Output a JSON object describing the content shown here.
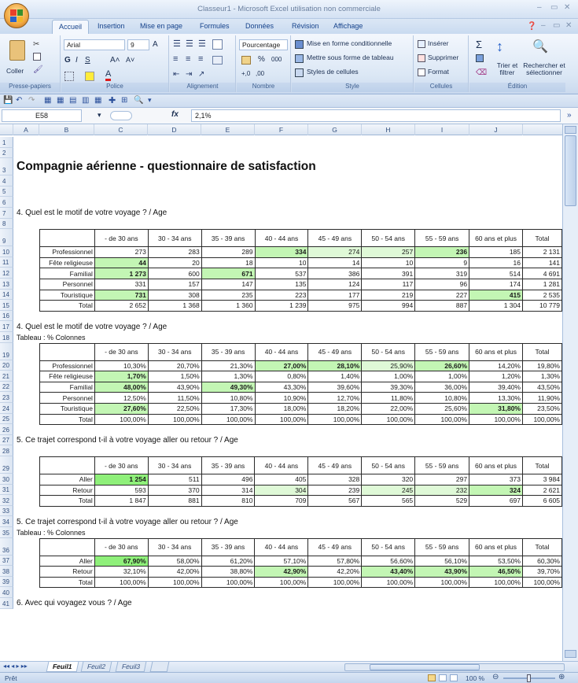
{
  "window": {
    "title": "Classeur1 - Microsoft Excel utilisation non commerciale"
  },
  "tabs": [
    "Accueil",
    "Insertion",
    "Mise en page",
    "Formules",
    "Données",
    "Révision",
    "Affichage"
  ],
  "ribbon": {
    "clipboard": {
      "paste": "Coller",
      "label": "Presse-papiers"
    },
    "font": {
      "name": "Arial",
      "size": "9",
      "label": "Police"
    },
    "alignment": {
      "label": "Alignement"
    },
    "number": {
      "format": "Pourcentage",
      "percent": "%",
      "thousands": "000",
      "label": "Nombre"
    },
    "style": {
      "cond": "Mise en forme conditionnelle",
      "table": "Mettre sous forme de tableau",
      "cell_styles": "Styles de cellules",
      "label": "Style"
    },
    "cells": {
      "insert": "Insérer",
      "delete": "Supprimer",
      "format": "Format",
      "label": "Cellules"
    },
    "editing": {
      "sort": "Trier et filtrer",
      "find": "Rechercher et sélectionner",
      "label": "Édition"
    }
  },
  "formula_bar": {
    "name_box": "E58",
    "fx": "fx",
    "value": "2,1%"
  },
  "columns": [
    "A",
    "B",
    "C",
    "D",
    "E",
    "F",
    "G",
    "H",
    "I",
    "J"
  ],
  "rows": [
    "1",
    "2",
    "3",
    "4",
    "5",
    "6",
    "7",
    "8",
    "9",
    "10",
    "11",
    "12",
    "13",
    "14",
    "15",
    "16",
    "17",
    "18",
    "19",
    "20",
    "21",
    "22",
    "23",
    "24",
    "25",
    "26",
    "27",
    "28",
    "29",
    "30",
    "31",
    "32",
    "33",
    "34",
    "35",
    "36",
    "37",
    "38",
    "39",
    "40",
    "41"
  ],
  "sheet": {
    "title": "Compagnie aérienne - questionnaire de satisfaction",
    "q1": "4. Quel est le motif de votre voyage ? / Age",
    "q2": "4. Quel est le motif de votre voyage ? / Age",
    "t2sub": "Tableau : % Colonnes",
    "q3": "5. Ce trajet correspond t-il à votre voyage aller ou retour ? / Age",
    "q4": "5. Ce trajet correspond t-il à votre voyage aller ou retour ? / Age",
    "t4sub": "Tableau : % Colonnes",
    "q5": "6. Avec qui voyagez vous ? / Age"
  },
  "age_headers": [
    "- de 30 ans",
    "30 - 34 ans",
    "35 - 39 ans",
    "40 - 44 ans",
    "45 - 49 ans",
    "50 - 54 ans",
    "55 - 59 ans",
    "60 ans et plus",
    "Total"
  ],
  "table1": [
    {
      "label": "Professionnel",
      "v": [
        "273",
        "283",
        "289",
        "334",
        "274",
        "257",
        "236",
        "185",
        "2 131"
      ]
    },
    {
      "label": "Fête religieuse",
      "v": [
        "44",
        "20",
        "18",
        "10",
        "14",
        "10",
        "9",
        "16",
        "141"
      ]
    },
    {
      "label": "Familial",
      "v": [
        "1 273",
        "600",
        "671",
        "537",
        "386",
        "391",
        "319",
        "514",
        "4 691"
      ]
    },
    {
      "label": "Personnel",
      "v": [
        "331",
        "157",
        "147",
        "135",
        "124",
        "117",
        "96",
        "174",
        "1 281"
      ]
    },
    {
      "label": "Touristique",
      "v": [
        "731",
        "308",
        "235",
        "223",
        "177",
        "219",
        "227",
        "415",
        "2 535"
      ]
    },
    {
      "label": "Total",
      "v": [
        "2 652",
        "1 368",
        "1 360",
        "1 239",
        "975",
        "994",
        "887",
        "1 304",
        "10 779"
      ]
    }
  ],
  "table2": [
    {
      "label": "Professionnel",
      "v": [
        "10,30%",
        "20,70%",
        "21,30%",
        "27,00%",
        "28,10%",
        "25,90%",
        "26,60%",
        "14,20%",
        "19,80%"
      ]
    },
    {
      "label": "Fête religieuse",
      "v": [
        "1,70%",
        "1,50%",
        "1,30%",
        "0,80%",
        "1,40%",
        "1,00%",
        "1,00%",
        "1,20%",
        "1,30%"
      ]
    },
    {
      "label": "Familial",
      "v": [
        "48,00%",
        "43,90%",
        "49,30%",
        "43,30%",
        "39,60%",
        "39,30%",
        "36,00%",
        "39,40%",
        "43,50%"
      ]
    },
    {
      "label": "Personnel",
      "v": [
        "12,50%",
        "11,50%",
        "10,80%",
        "10,90%",
        "12,70%",
        "11,80%",
        "10,80%",
        "13,30%",
        "11,90%"
      ]
    },
    {
      "label": "Touristique",
      "v": [
        "27,60%",
        "22,50%",
        "17,30%",
        "18,00%",
        "18,20%",
        "22,00%",
        "25,60%",
        "31,80%",
        "23,50%"
      ]
    },
    {
      "label": "Total",
      "v": [
        "100,00%",
        "100,00%",
        "100,00%",
        "100,00%",
        "100,00%",
        "100,00%",
        "100,00%",
        "100,00%",
        "100,00%"
      ]
    }
  ],
  "table3": [
    {
      "label": "Aller",
      "v": [
        "1 254",
        "511",
        "496",
        "405",
        "328",
        "320",
        "297",
        "373",
        "3 984"
      ]
    },
    {
      "label": "Retour",
      "v": [
        "593",
        "370",
        "314",
        "304",
        "239",
        "245",
        "232",
        "324",
        "2 621"
      ]
    },
    {
      "label": "Total",
      "v": [
        "1 847",
        "881",
        "810",
        "709",
        "567",
        "565",
        "529",
        "697",
        "6 605"
      ]
    }
  ],
  "table4": [
    {
      "label": "Aller",
      "v": [
        "67,90%",
        "58,00%",
        "61,20%",
        "57,10%",
        "57,80%",
        "56,60%",
        "56,10%",
        "53,50%",
        "60,30%"
      ]
    },
    {
      "label": "Retour",
      "v": [
        "32,10%",
        "42,00%",
        "38,80%",
        "42,90%",
        "42,20%",
        "43,40%",
        "43,90%",
        "46,50%",
        "39,70%"
      ]
    },
    {
      "label": "Total",
      "v": [
        "100,00%",
        "100,00%",
        "100,00%",
        "100,00%",
        "100,00%",
        "100,00%",
        "100,00%",
        "100,00%",
        "100,00%"
      ]
    }
  ],
  "sheet_tabs": [
    "Feuil1",
    "Feuil2",
    "Feuil3"
  ],
  "status": {
    "ready": "Prêt",
    "zoom": "100 %"
  }
}
